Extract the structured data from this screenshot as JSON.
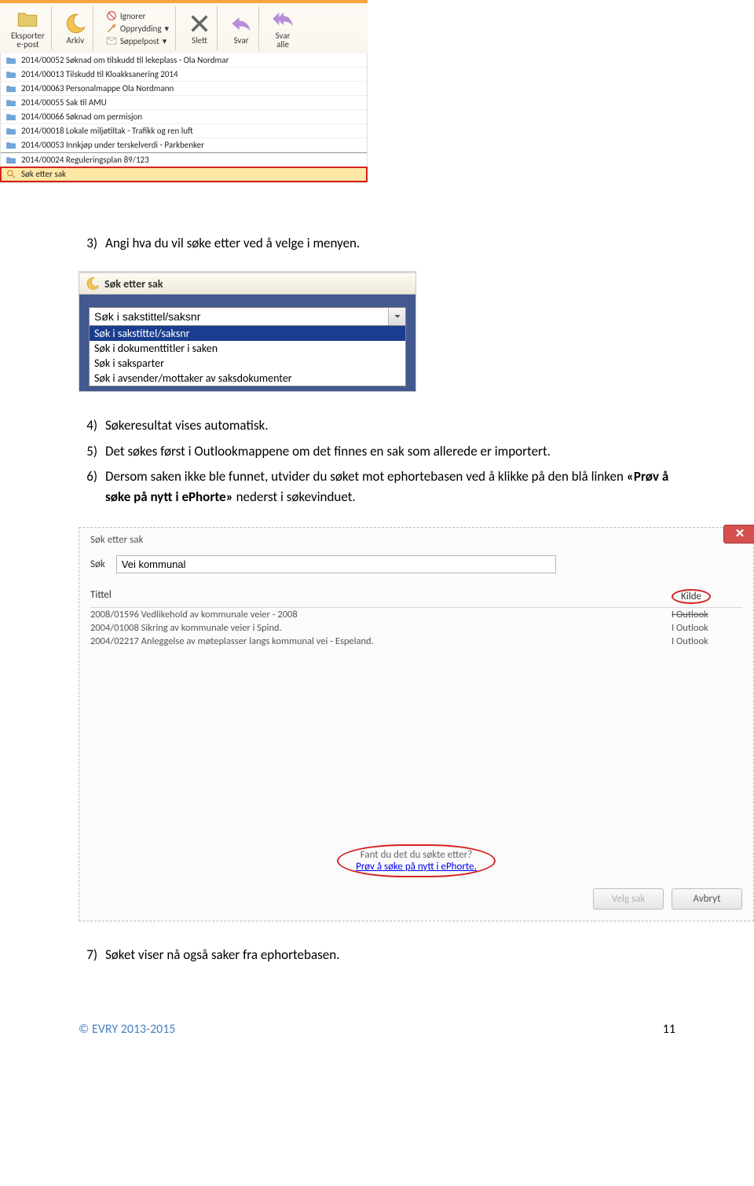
{
  "ribbon": {
    "eksporter": "Eksporter\ne-post",
    "arkiv": "Arkiv",
    "ignorer": "Ignorer",
    "opprydding": "Opprydding",
    "soppelpost": "Søppelpost",
    "slett": "Slett",
    "svar": "Svar",
    "svar_alle": "Svar\nalle"
  },
  "mail_items": [
    "2014/00052 Søknad om tilskudd til lekeplass - Ola Nordmar",
    "2014/00013 Tilskudd til Kloakksanering 2014",
    "2014/00063 Personalmappe Ola Nordmann",
    "2014/00055 Sak til AMU",
    "2014/00066 Søknad om permisjon",
    "2014/00018 Lokale miljøtiltak - Trafikk og ren luft",
    "2014/00053 Innkjøp under terskelverdi - Parkbenker",
    "2014/00024 Reguleringsplan 89/123"
  ],
  "mail_highlight": "Søk etter sak",
  "steps": {
    "s3": "Angi hva du vil søke etter ved å velge i menyen.",
    "s4": "Søkeresultat vises automatisk.",
    "s5": "Det søkes først i Outlookmappene om det finnes en sak som allerede er importert.",
    "s6a": "Dersom saken ikke ble funnet, utvider du søket mot ephortebasen ved å klikke på den blå linken ",
    "s6b": "«Prøv å søke på nytt i ePhorte»",
    "s6c": " nederst i søkevinduet.",
    "s7": "Søket viser nå også saker fra ephortebasen."
  },
  "sok_etter_sak": {
    "title": "Søk etter sak",
    "field_value": "Søk i sakstittel/saksnr",
    "options": [
      "Søk i sakstittel/saksnr",
      "Søk i dokumenttitler i saken",
      "Søk i saksparter",
      "Søk i avsender/mottaker av saksdokumenter"
    ]
  },
  "dialog": {
    "title": "Søk etter sak",
    "search_label": "Søk",
    "search_value": "Vei kommunal",
    "col_title": "Tittel",
    "col_kilde": "Kilde",
    "results": [
      {
        "title": "2008/01596 Vedlikehold av kommunale veier - 2008",
        "kilde": "I Outlook",
        "strike": true
      },
      {
        "title": "2004/01008 Sikring av kommunale veier i Spind.",
        "kilde": "I Outlook",
        "strike": false
      },
      {
        "title": "2004/02217 Anleggelse av møteplasser langs kommunal vei - Espeland.",
        "kilde": "I Outlook",
        "strike": false
      }
    ],
    "fant": "Fant du det du søkte etter?",
    "bluelink": "Prøv å søke på nytt i ePhorte.",
    "btn_velg": "Velg sak",
    "btn_avbryt": "Avbryt"
  },
  "footer": {
    "left": "© EVRY 2013-2015",
    "right": "11"
  }
}
